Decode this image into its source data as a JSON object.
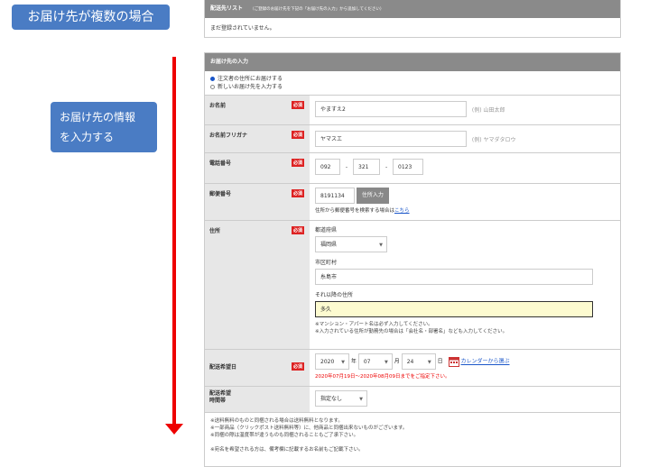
{
  "callouts": {
    "title": "お届け先が複数の場合",
    "info_line1": "お届け先の情報",
    "info_line2": "を入力する"
  },
  "list_panel": {
    "title": "配送先リスト",
    "subtitle": "（ご登録のお届け先を下記の「お届け先の入力」から追加してください）",
    "empty": "まだ登録されていません。"
  },
  "entry": {
    "title": "お届け先の入力",
    "radio_1": "注文者の住所にお届けする",
    "radio_2": "新しいお届け先を入力する",
    "required": "必須",
    "name": {
      "label": "お名前",
      "value": "やますえ2",
      "hint": "(例) 山田太郎"
    },
    "kana": {
      "label": "お名前フリガナ",
      "value": "ヤマスエ",
      "hint": "(例) ヤマダタロウ"
    },
    "phone": {
      "label": "電話番号",
      "p1": "092",
      "p2": "321",
      "p3": "0123",
      "sep": "-"
    },
    "zip": {
      "label": "郵便番号",
      "value": "8191134",
      "button": "住所入力",
      "help": "住所から郵便番号を検索する場合は",
      "link": "こちら"
    },
    "address": {
      "label": "住所",
      "pref_label": "都道府県",
      "pref_value": "福岡県",
      "city_label": "市区町村",
      "city_value": "糸島市",
      "rest_label": "それ以降の住所",
      "rest_value": "多久",
      "note1": "※マンション・アパート名は必ず入力してください。",
      "note2": "※入力されている住所が勤務先の場合は「会社名・部署名」なども入力してください。"
    },
    "date": {
      "label": "配送希望日",
      "year": "2020",
      "year_unit": "年",
      "month": "07",
      "month_unit": "月",
      "day": "24",
      "day_unit": "日",
      "calendar_link": "カレンダーから選ぶ",
      "range": "2020年07月19日〜2020年08月09日までをご指定下さい。"
    },
    "time": {
      "label_1": "配送希望",
      "label_2": "時間帯",
      "value": "指定なし"
    },
    "footer_notes": [
      "※送料無料のものと同梱される場合は送料無料となります。",
      "※一部商品（クリックポスト送料無料等）に、他商品と同梱出来ないものがございます。",
      "※同梱の際は温度帯が違うものも同梱されることもご了承下さい。"
    ],
    "footer_red": "※宛名を希望される方は、備考欄に記載するお名前もご記載下さい。"
  },
  "colors": {
    "accent": "#4a7cc4",
    "arrow": "#e00000",
    "required": "#dd2222",
    "highlight_field": "#fdfbd0"
  }
}
